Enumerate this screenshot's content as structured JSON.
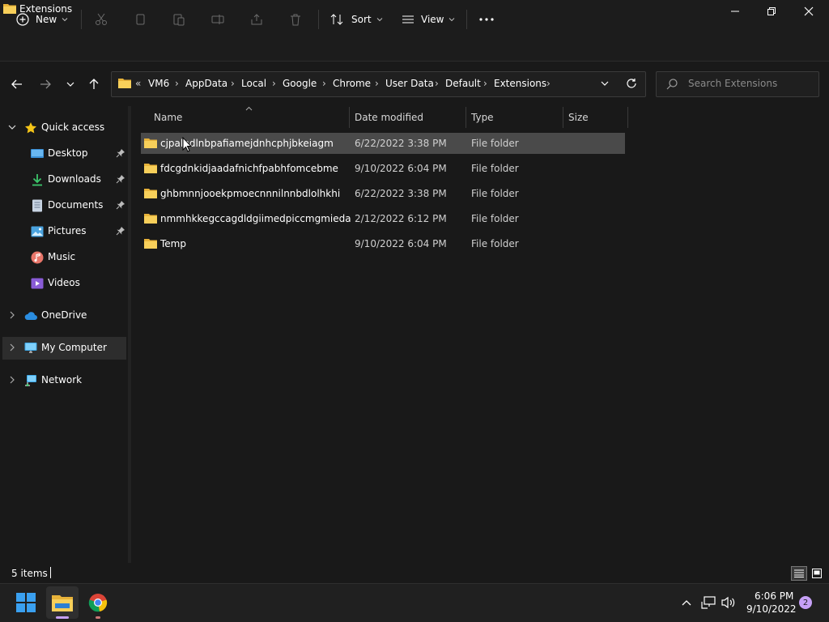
{
  "window": {
    "title": "Extensions"
  },
  "toolbar": {
    "new_label": "New",
    "sort_label": "Sort",
    "view_label": "View"
  },
  "address": {
    "overflow": "«",
    "crumbs": [
      "VM6",
      "AppData",
      "Local",
      "Google",
      "Chrome",
      "User Data",
      "Default",
      "Extensions"
    ],
    "separator": "›"
  },
  "search": {
    "placeholder": "Search Extensions"
  },
  "sidebar": {
    "quick_access": "Quick access",
    "items": [
      {
        "label": "Desktop",
        "pinned": true
      },
      {
        "label": "Downloads",
        "pinned": true
      },
      {
        "label": "Documents",
        "pinned": true
      },
      {
        "label": "Pictures",
        "pinned": true
      },
      {
        "label": "Music",
        "pinned": false
      },
      {
        "label": "Videos",
        "pinned": false
      }
    ],
    "onedrive": "OneDrive",
    "my_computer": "My Computer",
    "network": "Network"
  },
  "columns": {
    "name": "Name",
    "date": "Date modified",
    "type": "Type",
    "size": "Size"
  },
  "files": [
    {
      "name": "cjpalhdlnbpafiamejdnhcphjbkeiagm",
      "date": "6/22/2022 3:38 PM",
      "type": "File folder",
      "size": ""
    },
    {
      "name": "fdcgdnkidjaadafnichfpabhfomcebme",
      "date": "9/10/2022 6:04 PM",
      "type": "File folder",
      "size": ""
    },
    {
      "name": "ghbmnnjooekpmoecnnnilnnbdlolhkhi",
      "date": "6/22/2022 3:38 PM",
      "type": "File folder",
      "size": ""
    },
    {
      "name": "nmmhkkegccagdldgiimedpiccmgmieda",
      "date": "2/12/2022 6:12 PM",
      "type": "File folder",
      "size": ""
    },
    {
      "name": "Temp",
      "date": "9/10/2022 6:04 PM",
      "type": "File folder",
      "size": ""
    }
  ],
  "status": {
    "items_text": "5 items"
  },
  "taskbar": {
    "time": "6:06 PM",
    "date": "9/10/2022",
    "notifications": "2"
  },
  "colors": {
    "folder": "#f2c94c",
    "accent": "#4cc2ff",
    "selected_row": "#4a4a4a",
    "background": "#191919"
  }
}
